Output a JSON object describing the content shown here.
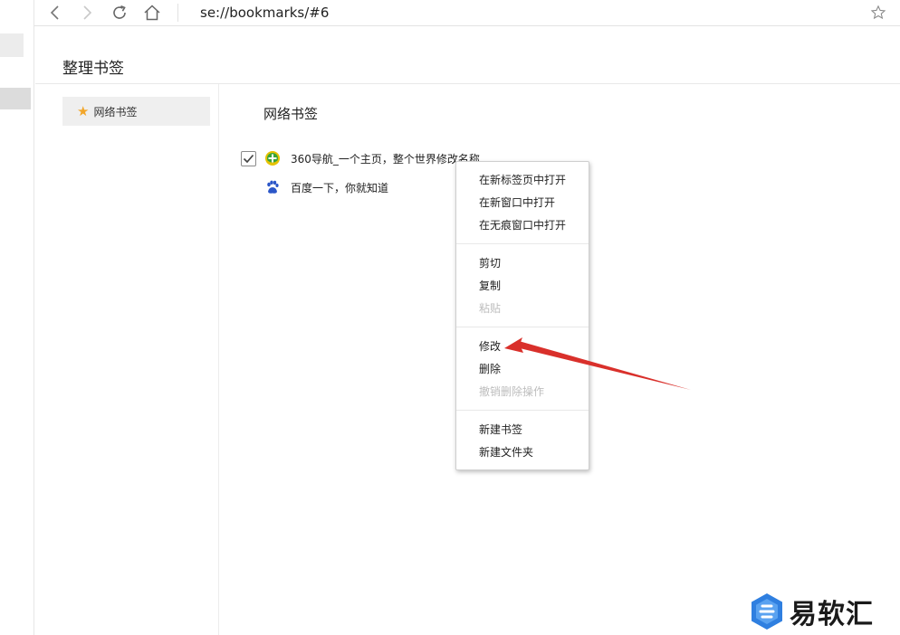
{
  "toolbar": {
    "url": "se://bookmarks/#6"
  },
  "page": {
    "title": "整理书签"
  },
  "sidebar": {
    "items": [
      {
        "label": "网络书签",
        "icon": "star-icon"
      }
    ]
  },
  "main": {
    "section_title": "网络书签",
    "bookmarks": [
      {
        "title": "360导航_一个主页，整个世界修改名称",
        "icon": "360-icon",
        "checked": true
      },
      {
        "title": "百度一下，你就知道",
        "icon": "baidu-paw-icon",
        "checked": false
      }
    ]
  },
  "context_menu": {
    "groups": [
      [
        {
          "label": "在新标签页中打开",
          "disabled": false
        },
        {
          "label": "在新窗口中打开",
          "disabled": false
        },
        {
          "label": "在无痕窗口中打开",
          "disabled": false
        }
      ],
      [
        {
          "label": "剪切",
          "disabled": false
        },
        {
          "label": "复制",
          "disabled": false
        },
        {
          "label": "粘贴",
          "disabled": true
        }
      ],
      [
        {
          "label": "修改",
          "disabled": false
        },
        {
          "label": "删除",
          "disabled": false
        },
        {
          "label": "撤销删除操作",
          "disabled": true
        }
      ],
      [
        {
          "label": "新建书签",
          "disabled": false
        },
        {
          "label": "新建文件夹",
          "disabled": false
        }
      ]
    ]
  },
  "watermark": {
    "text": "易软汇"
  },
  "colors": {
    "accent_star": "#f2a629",
    "annotation_arrow": "#d9302b",
    "watermark_blue": "#2f7fe0"
  }
}
